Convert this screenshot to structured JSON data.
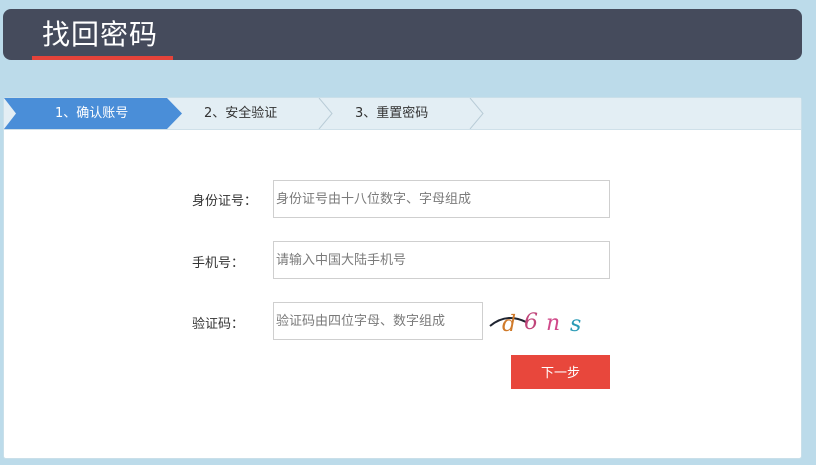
{
  "header": {
    "title": "找回密码"
  },
  "steps": [
    {
      "label": "1、确认账号",
      "active": true
    },
    {
      "label": "2、安全验证",
      "active": false
    },
    {
      "label": "3、重置密码",
      "active": false
    }
  ],
  "form": {
    "id_card": {
      "label": "身份证号：",
      "placeholder": "身份证号由十八位数字、字母组成",
      "value": ""
    },
    "phone": {
      "label": "手机号：",
      "placeholder": "请输入中国大陆手机号",
      "value": ""
    },
    "captcha": {
      "label": "验证码：",
      "placeholder": "验证码由四位字母、数字组成",
      "value": "",
      "image_text": "d6ns"
    },
    "next_label": "下一步"
  },
  "colors": {
    "page_bg": "#bcdbea",
    "header_bg": "#454b5c",
    "accent_red": "#e4433a",
    "active_step": "#4a8ed8",
    "button_red": "#e8473c"
  }
}
